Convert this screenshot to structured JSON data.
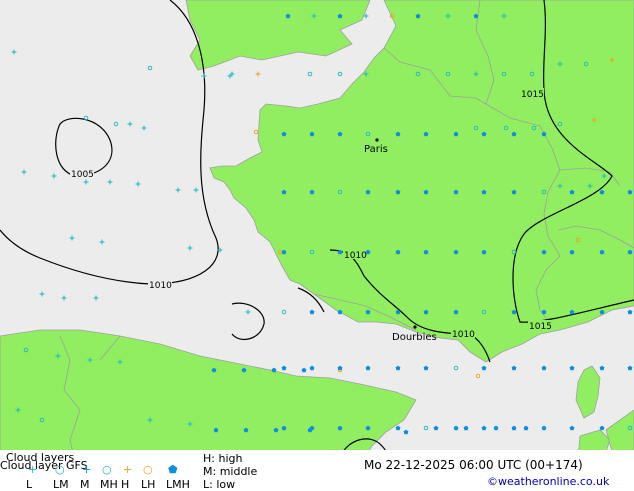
{
  "map": {
    "cities": [
      {
        "name": "Paris"
      },
      {
        "name": "Dourbies"
      }
    ],
    "isobars": [
      "1005",
      "1010",
      "1010",
      "1010",
      "1010",
      "1015",
      "1015"
    ]
  },
  "legend": {
    "title": "Cloud layers",
    "subtitle": "Cloud layer  GFS",
    "symbols": [
      {
        "label": "L",
        "icon": "plus",
        "color": "#1ab8c4"
      },
      {
        "label": "LM",
        "icon": "circle",
        "color": "#1ab8c4"
      },
      {
        "label": "M",
        "icon": "plus",
        "color": "#0d8fe0"
      },
      {
        "label": "MH",
        "icon": "circle",
        "color": "#1ab8c4"
      },
      {
        "label": "H",
        "icon": "plus",
        "color": "#f0a020"
      },
      {
        "label": "LH",
        "icon": "circle",
        "color": "#f0a020"
      },
      {
        "label": "LMH",
        "icon": "pentagon",
        "color": "#0d8fe0"
      }
    ],
    "levels": [
      "H: high",
      "M: middle",
      "L: low"
    ],
    "datetime": "Mo 22-12-2025 06:00 UTC (00+174)",
    "copyright": "©weatheronline.co.uk"
  },
  "colors": {
    "land": "#90ee60",
    "sea": "#ececec",
    "border": "#a0a0a0",
    "isobar": "#000000",
    "low_cloud": "#1ab8c4",
    "mid_cloud": "#0d8fe0",
    "high_cloud": "#f0a020"
  }
}
